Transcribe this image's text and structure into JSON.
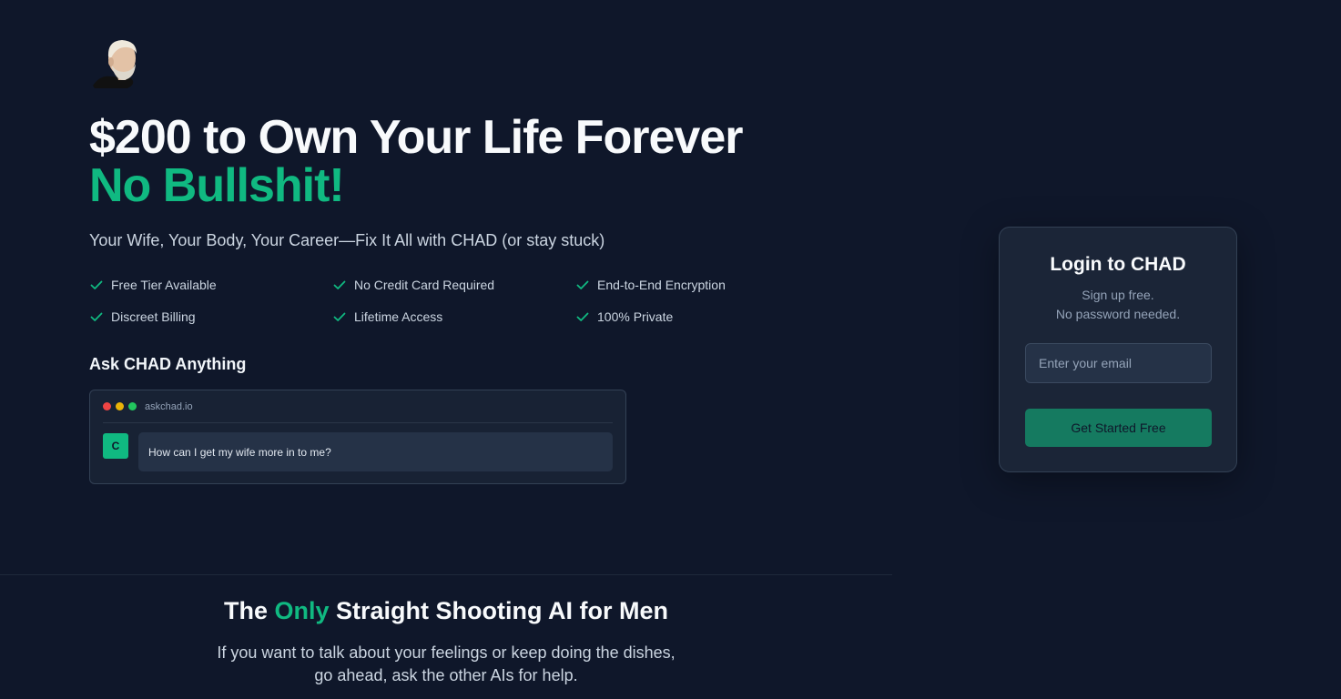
{
  "hero": {
    "headline": "$200 to Own Your Life Forever",
    "headline_accent": "No Bullshit!",
    "subtitle": "Your Wife, Your Body, Your Career—Fix It All with CHAD (or stay stuck)"
  },
  "features": [
    {
      "label": "Free Tier Available",
      "icon": "check-icon"
    },
    {
      "label": "No Credit Card Required",
      "icon": "check-icon"
    },
    {
      "label": "End-to-End Encryption",
      "icon": "check-icon"
    },
    {
      "label": "Discreet Billing",
      "icon": "check-icon"
    },
    {
      "label": "Lifetime Access",
      "icon": "check-icon"
    },
    {
      "label": "100% Private",
      "icon": "check-icon"
    }
  ],
  "ask": {
    "title": "Ask CHAD Anything",
    "browser_url": "askchad.io",
    "avatar_letter": "C",
    "message": "How can I get my wife more in to me?"
  },
  "bottom": {
    "title_before": "The ",
    "title_accent": "Only",
    "title_after": " Straight Shooting AI for Men",
    "text_line1": "If you want to talk about your feelings or keep doing the dishes,",
    "text_line2": "go ahead, ask the other AIs for help."
  },
  "login": {
    "title": "Login to CHAD",
    "sub_line1": "Sign up free.",
    "sub_line2": "No password needed.",
    "email_placeholder": "Enter your email",
    "button_label": "Get Started Free"
  },
  "colors": {
    "background": "#0f172a",
    "accent": "#10b981",
    "button": "#157a60",
    "card": "#1b2537"
  }
}
